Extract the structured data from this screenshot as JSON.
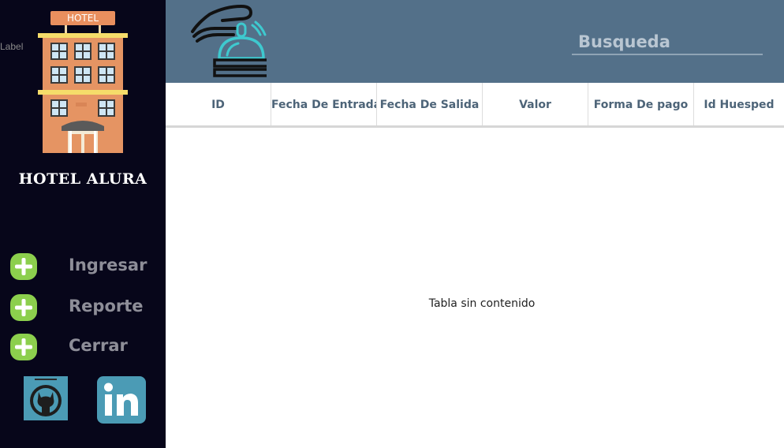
{
  "stray_label": "Label",
  "logo": {
    "sign_text": "HOTEL"
  },
  "sidebar": {
    "hotel_name": "HOTEL ALURA",
    "menu": [
      {
        "label": "Ingresar",
        "icon": "plus-icon"
      },
      {
        "label": "Reporte",
        "icon": "plus-icon"
      },
      {
        "label": "Cerrar",
        "icon": "plus-icon"
      }
    ],
    "social": [
      {
        "icon": "github-icon"
      },
      {
        "icon": "linkedin-icon"
      }
    ]
  },
  "header": {
    "icon": "reception-bell-icon",
    "search": {
      "placeholder": "Busqueda",
      "value": ""
    }
  },
  "table": {
    "columns": [
      "ID",
      "Fecha De Entrada",
      "Fecha De Salida",
      "Valor",
      "Forma De pago",
      "Id Huesped"
    ],
    "rows": [],
    "empty_message": "Tabla sin contenido"
  },
  "colors": {
    "sidebar_bg": "#07061a",
    "header_bg": "#537089",
    "accent_green": "#8ccf4d",
    "header_text": "#4d6478"
  }
}
